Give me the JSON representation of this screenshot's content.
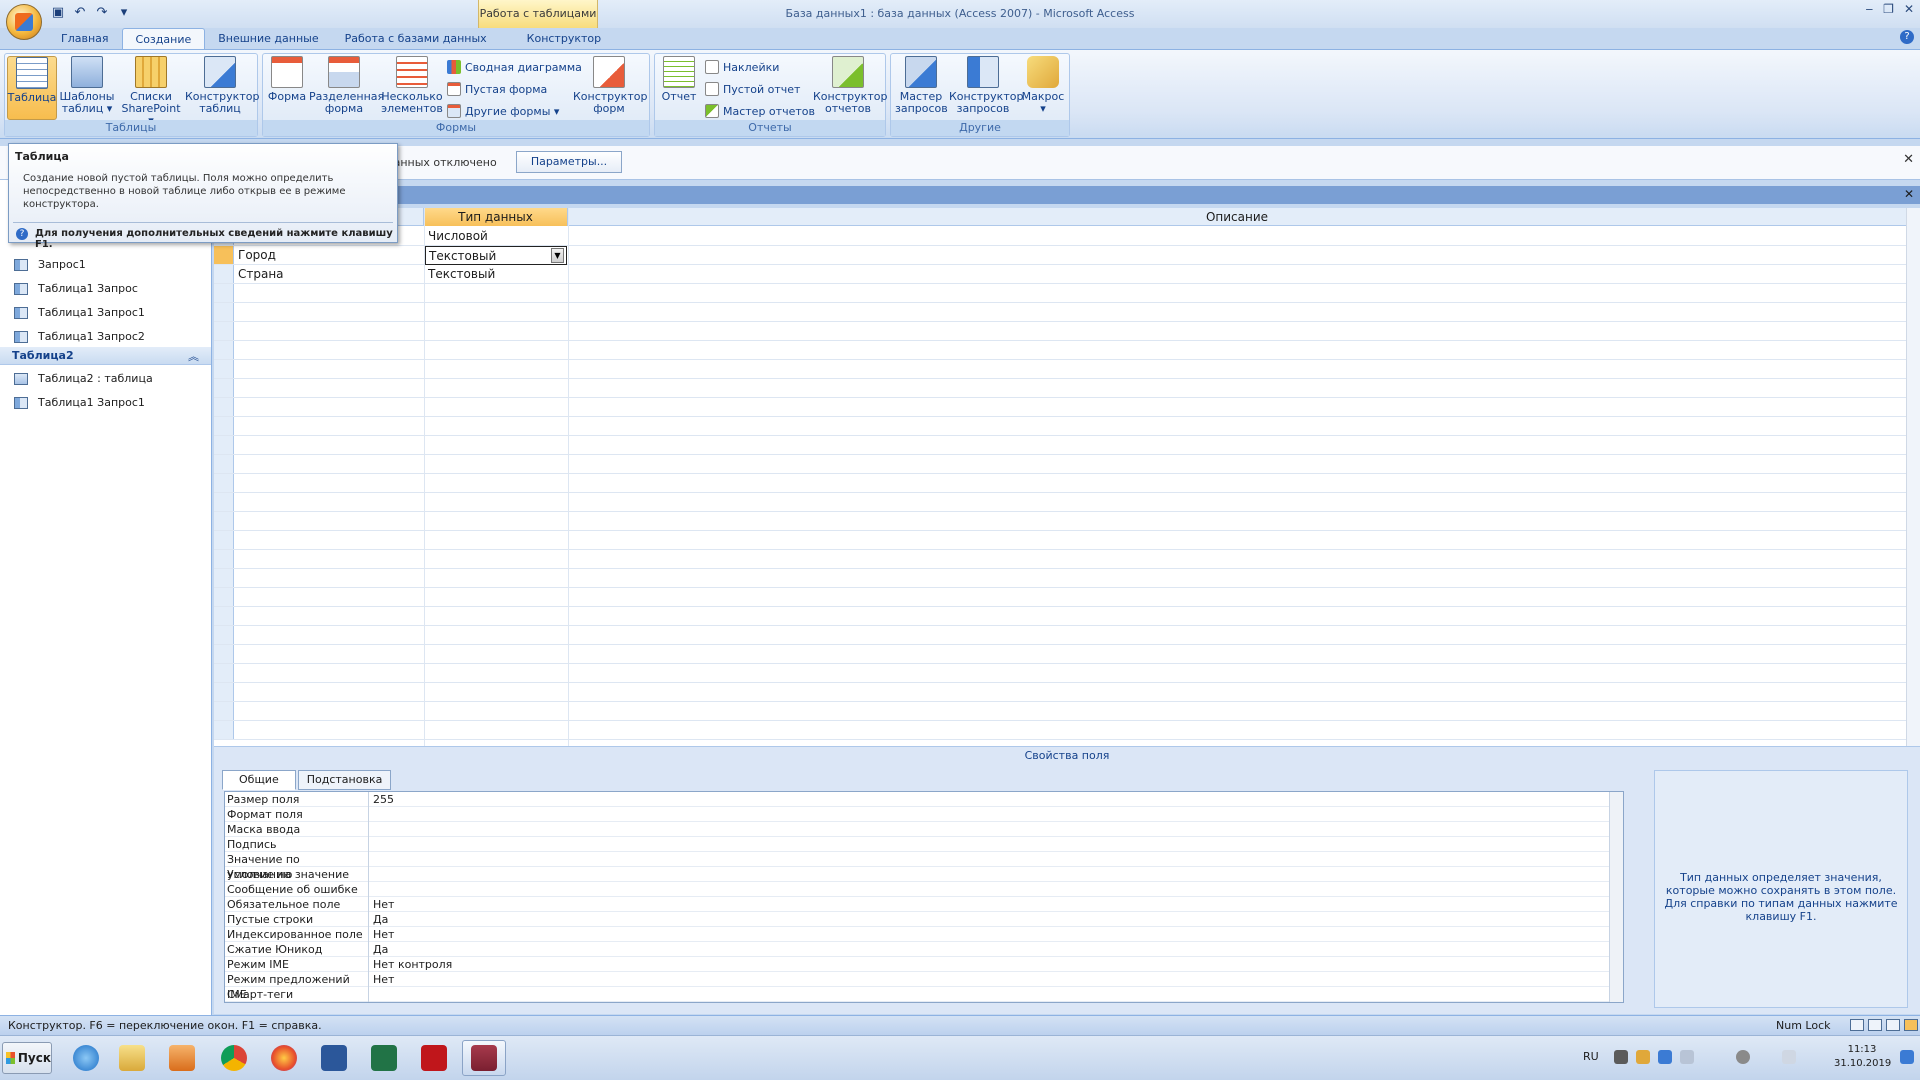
{
  "window": {
    "title": "База данных1 : база данных (Access 2007) - Microsoft Access",
    "context_tab_header": "Работа с таблицами"
  },
  "qat": {
    "icons": [
      "save-icon",
      "undo-icon",
      "redo-icon",
      "customize-icon"
    ]
  },
  "tabs": [
    "Главная",
    "Создание",
    "Внешние данные",
    "Работа с базами данных",
    "Конструктор"
  ],
  "ribbon": {
    "tables": {
      "label": "Таблицы",
      "table": "Таблица",
      "templates": "Шаблоны таблиц ▾",
      "sharepoint": "Списки SharePoint ▾",
      "designer": "Конструктор таблиц"
    },
    "forms": {
      "label": "Формы",
      "form": "Форма",
      "split": "Разделенная форма",
      "multiple": "Несколько элементов",
      "pivot": "Сводная диаграмма",
      "blank": "Пустая форма",
      "more": "Другие формы ▾",
      "designer": "Конструктор форм"
    },
    "reports": {
      "label": "Отчеты",
      "report": "Отчет",
      "labels": "Наклейки",
      "blank": "Пустой отчет",
      "wizard": "Мастер отчетов",
      "designer": "Конструктор отчетов"
    },
    "other": {
      "label": "Другие",
      "query_wizard": "Мастер запросов",
      "query_designer": "Конструктор запросов",
      "macro": "Макрос ▾"
    }
  },
  "msgbar": {
    "text": "данных отключено",
    "button": "Параметры..."
  },
  "tooltip": {
    "title": "Таблица",
    "body": "Создание новой пустой таблицы. Поля можно определить непосредственно в новой таблице либо открыв ее в режиме конструктора.",
    "footer": "Для получения дополнительных сведений нажмите клавишу F1."
  },
  "nav": {
    "items_top": [
      "Запрос1",
      "Таблица1 Запрос",
      "Таблица1 Запрос1",
      "Таблица1 Запрос2"
    ],
    "group2": "Таблица2",
    "items_group2": [
      "Таблица2 : таблица",
      "Таблица1 Запрос1"
    ]
  },
  "grid": {
    "col_type": "Тип данных",
    "col_desc": "Описание",
    "rows": [
      {
        "name": "",
        "type": "Числовой"
      },
      {
        "name": "Город",
        "type": "Текстовый"
      },
      {
        "name": "Страна",
        "type": "Текстовый"
      }
    ]
  },
  "props": {
    "caption": "Свойства поля",
    "tab_general": "Общие",
    "tab_lookup": "Подстановка",
    "rows": [
      {
        "name": "Размер поля",
        "value": "255"
      },
      {
        "name": "Формат поля",
        "value": ""
      },
      {
        "name": "Маска ввода",
        "value": ""
      },
      {
        "name": "Подпись",
        "value": ""
      },
      {
        "name": "Значение по умолчанию",
        "value": ""
      },
      {
        "name": "Условие на значение",
        "value": ""
      },
      {
        "name": "Сообщение об ошибке",
        "value": ""
      },
      {
        "name": "Обязательное поле",
        "value": "Нет"
      },
      {
        "name": "Пустые строки",
        "value": "Да"
      },
      {
        "name": "Индексированное поле",
        "value": "Нет"
      },
      {
        "name": "Сжатие Юникод",
        "value": "Да"
      },
      {
        "name": "Режим IME",
        "value": "Нет контроля"
      },
      {
        "name": "Режим предложений IME",
        "value": "Нет"
      },
      {
        "name": "Смарт-теги",
        "value": ""
      }
    ],
    "help": "Тип данных определяет значения, которые можно сохранять в этом поле.  Для справки по типам данных нажмите клавишу F1."
  },
  "status": {
    "text": "Конструктор.  F6 = переключение окон.  F1 = справка.",
    "numlock": "Num Lock"
  },
  "taskbar": {
    "start": "Пуск",
    "lang": "RU",
    "time": "11:13",
    "date": "31.10.2019"
  }
}
